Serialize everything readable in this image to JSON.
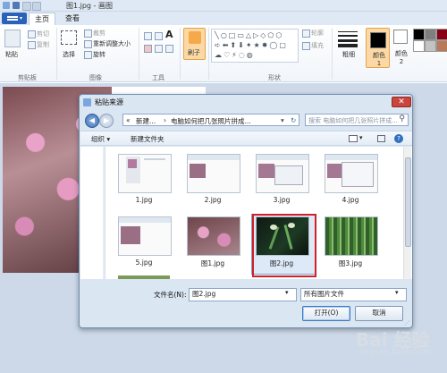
{
  "app": {
    "title": "图1.jpg - 画图",
    "tabs": {
      "home": "主页",
      "view": "查看"
    }
  },
  "ribbon": {
    "clipboard": {
      "paste": "粘贴",
      "cut": "剪切",
      "copy": "复制",
      "group": "剪贴板"
    },
    "image": {
      "select": "选择",
      "crop": "裁剪",
      "resize": "重新调整大小",
      "rotate": "旋转",
      "group": "图像"
    },
    "tools": {
      "group": "工具"
    },
    "brushes": {
      "label": "刷子"
    },
    "shapes": {
      "outline": "轮廓",
      "fill": "填充",
      "group": "形状"
    },
    "size": {
      "label": "粗细"
    },
    "color1": {
      "label": "颜色 1"
    },
    "color2": {
      "label": "颜色 2"
    }
  },
  "dialog": {
    "title": "粘贴来源",
    "close": "✕",
    "address": {
      "root": "«",
      "part1": "新建...",
      "sep": "›",
      "part2": "电脑如何把几张照片拼成..."
    },
    "search_placeholder": "搜索 电脑如何把几张照片拼成...",
    "toolbar": {
      "organize": "组织 ▾",
      "new_folder": "新建文件夹"
    },
    "files": [
      {
        "name": "1.jpg"
      },
      {
        "name": "2.jpg"
      },
      {
        "name": "3.jpg"
      },
      {
        "name": "4.jpg"
      },
      {
        "name": "5.jpg"
      },
      {
        "name": "图1.jpg"
      },
      {
        "name": "图2.jpg",
        "selected": true
      },
      {
        "name": "图3.jpg"
      }
    ],
    "filename_label": "文件名(N):",
    "filename_value": "图2.jpg",
    "filter_value": "所有图片文件",
    "open": "打开(O)",
    "cancel": "取消"
  },
  "watermark": {
    "main": "Bai 经验",
    "sub": "jingyan.baidu.com"
  },
  "colors": {
    "accent": "#2a62b8",
    "selection": "#d0202a",
    "orange_tool": "#f5a94b"
  }
}
